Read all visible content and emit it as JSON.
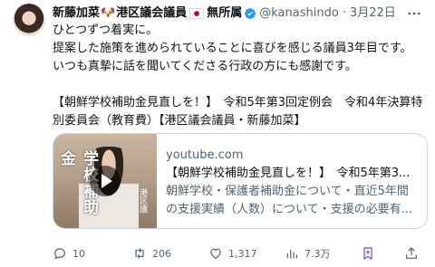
{
  "author": {
    "name": "新藤加菜",
    "name_emoji": "🐶",
    "affiliation": "港区議会議員",
    "party": "無所属",
    "handle": "@kanashindo",
    "separator": "·",
    "date": "3月22日"
  },
  "body": {
    "lines": [
      "ひとつずつ着実に。",
      "提案した施策を進められていることに喜びを感じる議員3年目です。",
      "いつも真摯に話を聞いてくださる行政の方にも感謝です。"
    ],
    "tag_line_1": "【朝鮮学校補助金見直しを！】　令和5年第3回定例会　令和4年決算特",
    "tag_line_2": "別委員会（教育費）【港区議会議員・新藤加菜】"
  },
  "card": {
    "domain": "youtube.com",
    "title": "【朝鮮学校補助金見直しを！】　令和5年第3...",
    "desc_line_1": "朝鮮学校・保護者補助金について・直近5年間",
    "desc_line_2": "の支援実績（人数）について・支援の必要有...",
    "thumb_sign": "学校補助金",
    "thumb_sign_small": "港区議"
  },
  "actions": {
    "replies": "10",
    "retweets": "206",
    "likes": "1,317",
    "views": "7.3万"
  },
  "colors": {
    "text": "#0f1419",
    "secondary": "#536471",
    "verified": "#1d9bf0",
    "bookmark_active": "#794bc4",
    "border": "#cfd9de"
  },
  "icons": {
    "reply": "reply-icon",
    "retweet": "retweet-icon",
    "like": "heart-icon",
    "views": "views-icon",
    "bookmark": "bookmark-icon",
    "share": "share-icon",
    "more": "more-icon",
    "verified": "verified-badge-icon"
  }
}
